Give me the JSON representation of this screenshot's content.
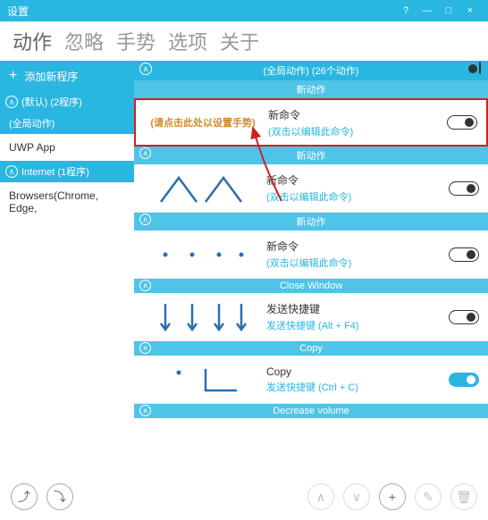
{
  "window": {
    "title": "设置",
    "help": "?",
    "min": "—",
    "max": "□",
    "close": "×"
  },
  "tabs": {
    "actions": "动作",
    "ignore": "忽略",
    "gestures": "手势",
    "options": "选项",
    "about": "关于"
  },
  "sidebar": {
    "add": "添加新程序",
    "default_header": "(默认) (2程序)",
    "global": "(全局动作)",
    "uwp": "UWP App",
    "internet_header": "Internet (1程序)",
    "browsers": "Browsers(Chrome, Edge,"
  },
  "groups": {
    "global_header": "(全局动作)   (26个动作)",
    "new_action": "新动作"
  },
  "actions": [
    {
      "gesture_prompt": "(请点击此处以设置手势)",
      "name": "新命令",
      "desc": "(双击以编辑此命令)",
      "on": false,
      "highlight": true
    },
    {
      "name": "新命令",
      "desc": "(双击以编辑此命令)",
      "on": false,
      "gesture": "peaks"
    },
    {
      "name": "新命令",
      "desc": "(双击以编辑此命令)",
      "on": false,
      "gesture": "dots"
    },
    {
      "section": "Close Window",
      "name": "发送快捷键",
      "desc": "发送快捷键 (Alt + F4)",
      "on": false,
      "gesture": "downs"
    },
    {
      "section": "Copy",
      "name": "Copy",
      "desc": "发送快捷键 (Ctrl + C)",
      "on": true,
      "gesture": "copy"
    },
    {
      "section": "Decrease volume"
    }
  ],
  "footer": {
    "export": "⤴",
    "import": "⤵",
    "up": "∧",
    "down": "∨",
    "add": "+",
    "edit": "✎",
    "delete": "🗑"
  }
}
